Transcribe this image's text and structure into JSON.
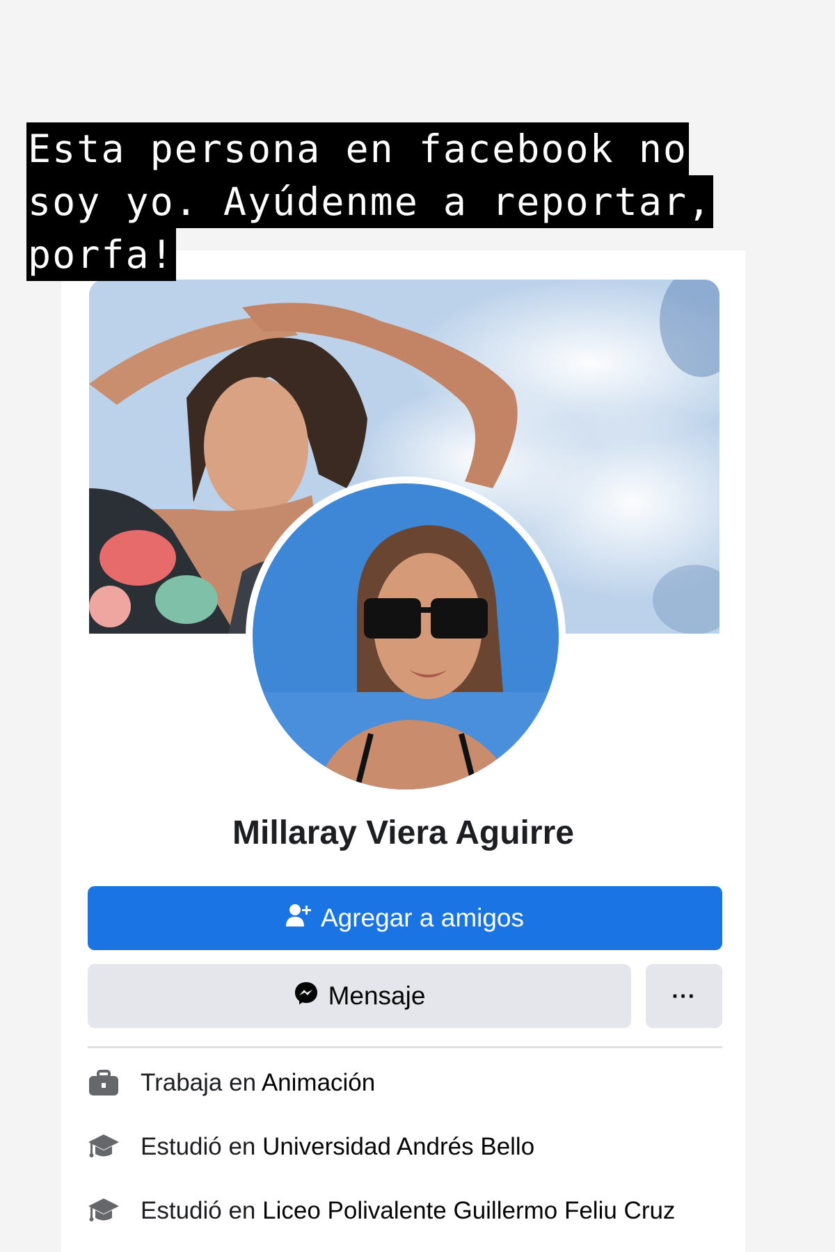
{
  "caption": {
    "lines": [
      "Esta persona en facebook no",
      "soy yo. Ayúdenme a reportar,",
      "porfa!"
    ]
  },
  "profile": {
    "name": "Millaray Viera Aguirre",
    "add_friend_label": "Agregar a amigos",
    "message_label": "Mensaje",
    "more_label": "···",
    "details": [
      {
        "icon": "briefcase-icon",
        "prefix": "Trabaja en ",
        "value": "Animación"
      },
      {
        "icon": "graduation-cap-icon",
        "prefix": "Estudió en ",
        "value": "Universidad Andrés Bello"
      },
      {
        "icon": "graduation-cap-icon",
        "prefix": "Estudió en ",
        "value": "Liceo Polivalente Guillermo Feliu Cruz"
      }
    ]
  },
  "colors": {
    "primary_button": "#1b74e4",
    "secondary_button": "#e4e6eb",
    "caption_background": "#000000",
    "caption_text": "#ffffff"
  }
}
